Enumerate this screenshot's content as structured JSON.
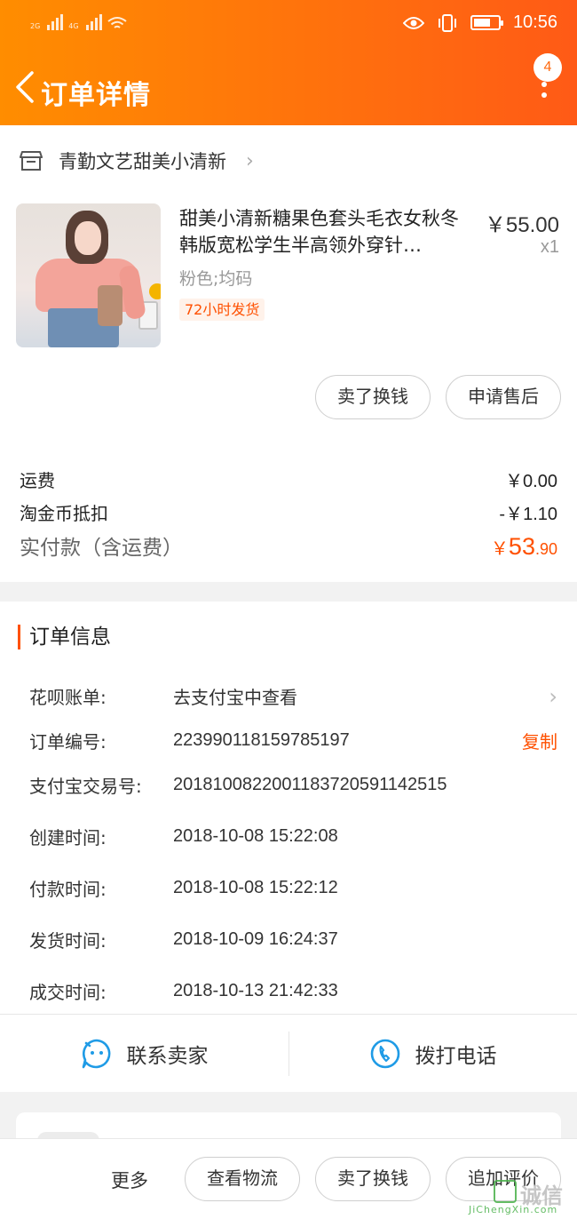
{
  "status_bar": {
    "net1": "2G",
    "net2": "4G",
    "time": "10:56"
  },
  "nav": {
    "title": "订单详情",
    "badge_count": "4"
  },
  "shop": {
    "name": "青勤文艺甜美小清新"
  },
  "item": {
    "title": "甜美小清新糖果色套头毛衣女秋冬韩版宽松学生半高领外穿针…",
    "price": "￥55.00",
    "qty": "x1",
    "sku": "粉色;均码",
    "tag": "72小时发货",
    "btn_sell": "卖了换钱",
    "btn_after_sale": "申请售后"
  },
  "summary": {
    "shipping_label": "运费",
    "shipping_value": "￥0.00",
    "coin_label": "淘金币抵扣",
    "coin_value": "-￥1.10",
    "paid_label": "实付款（含运费）",
    "paid_currency": "￥",
    "paid_int": "53",
    "paid_dec": ".90"
  },
  "order_info": {
    "section_title": "订单信息",
    "rows": [
      {
        "label": "花呗账单:",
        "value": "去支付宝中查看"
      },
      {
        "label": "订单编号:",
        "value": "223990118159785197",
        "action": "复制"
      },
      {
        "label": "支付宝交易号:",
        "value": "2018100822001183720591142515"
      },
      {
        "label": "创建时间:",
        "value": "2018-10-08 15:22:08"
      },
      {
        "label": "付款时间:",
        "value": "2018-10-08 15:22:12"
      },
      {
        "label": "发货时间:",
        "value": "2018-10-09 16:24:37"
      },
      {
        "label": "成交时间:",
        "value": "2018-10-13 21:42:33"
      }
    ],
    "contact_seller": "联系卖家",
    "call_phone": "拨打电话"
  },
  "bottom_bar": {
    "more": "更多",
    "logistics": "查看物流",
    "sell": "卖了换钱",
    "review": "追加评价"
  },
  "watermark": {
    "text": "诚信",
    "sub": "JiChengXin.com"
  },
  "colors": {
    "header_start": "#ff8d00",
    "header_end": "#ff5a16",
    "accent": "#ff5000",
    "icon_blue": "#1f9be6"
  }
}
